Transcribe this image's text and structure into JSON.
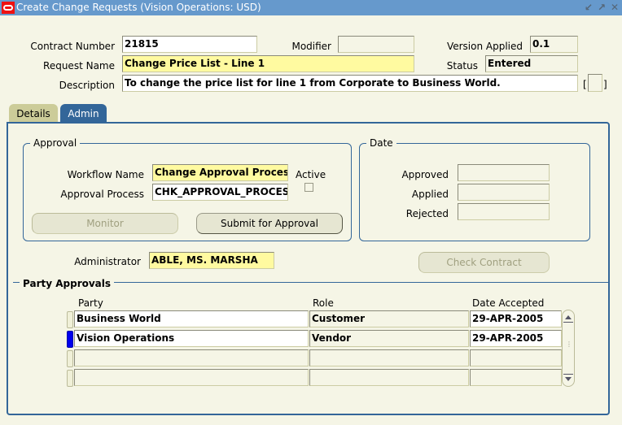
{
  "window": {
    "title": "Create Change Requests (Vision Operations: USD)",
    "controls": [
      "minimize-icon",
      "maximize-icon",
      "close-icon"
    ],
    "accent_color": "#6699cc"
  },
  "header": {
    "contract_number": {
      "label": "Contract Number",
      "value": "21815"
    },
    "modifier": {
      "label": "Modifier",
      "value": ""
    },
    "version_applied": {
      "label": "Version Applied",
      "value": "0.1"
    },
    "request_name": {
      "label": "Request Name",
      "value": "Change Price List - Line 1"
    },
    "status": {
      "label": "Status",
      "value": "Entered"
    },
    "description": {
      "label": "Description",
      "value": "To change the price list for line 1 from Corporate to Business World."
    },
    "dff_open": "[",
    "dff_close": "]"
  },
  "tabs": [
    {
      "label": "Details",
      "active": false
    },
    {
      "label": "Admin",
      "active": true
    }
  ],
  "approval": {
    "title": "Approval",
    "workflow_name": {
      "label": "Workflow Name",
      "value": "Change Approval Process"
    },
    "approval_process": {
      "label": "Approval Process",
      "value": "CHK_APPROVAL_PROCESS"
    },
    "active": {
      "label": "Active",
      "checked": false
    },
    "monitor_button": "Monitor",
    "submit_button": "Submit for Approval"
  },
  "date": {
    "title": "Date",
    "approved": {
      "label": "Approved",
      "value": ""
    },
    "applied": {
      "label": "Applied",
      "value": ""
    },
    "rejected": {
      "label": "Rejected",
      "value": ""
    }
  },
  "administrator": {
    "label": "Administrator",
    "value": "ABLE, MS. MARSHA"
  },
  "check_contract_button": "Check Contract",
  "party_approvals": {
    "title": "Party Approvals",
    "columns": [
      "Party",
      "Role",
      "Date Accepted"
    ],
    "rows": [
      {
        "party": "Business World",
        "role": "Customer",
        "date_accepted": "29-APR-2005",
        "current": false
      },
      {
        "party": "Vision Operations",
        "role": "Vendor",
        "date_accepted": "29-APR-2005",
        "current": true
      },
      {
        "party": "",
        "role": "",
        "date_accepted": "",
        "current": false
      },
      {
        "party": "",
        "role": "",
        "date_accepted": "",
        "current": false
      }
    ]
  }
}
